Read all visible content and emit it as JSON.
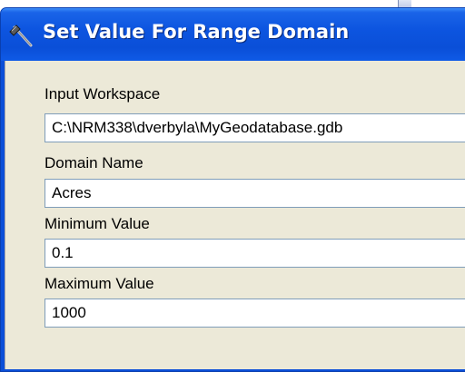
{
  "window": {
    "title": "Set Value For Range Domain",
    "title_icon": "hammer-icon"
  },
  "form": {
    "workspace": {
      "label": "Input Workspace",
      "value": "C:\\NRM338\\dverbyla\\MyGeodatabase.gdb"
    },
    "domain": {
      "label": "Domain Name",
      "value": "Acres"
    },
    "minimum": {
      "label": "Minimum Value",
      "value": "0.1"
    },
    "maximum": {
      "label": "Maximum Value",
      "value": "1000"
    }
  },
  "colors": {
    "titlebar": "#0a4fd8",
    "client": "#ece9d8",
    "field_border": "#7f9db9"
  }
}
